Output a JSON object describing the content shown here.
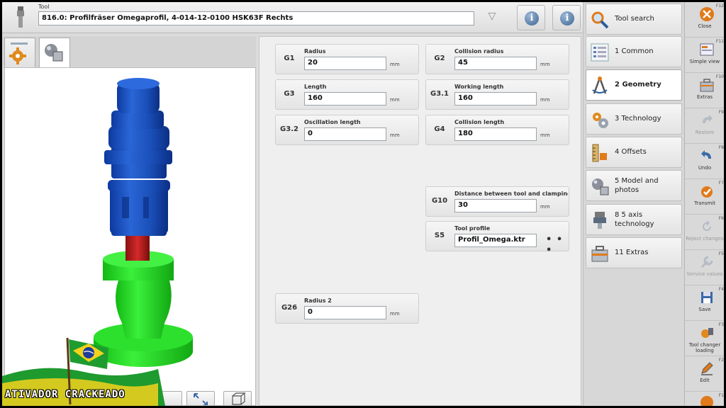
{
  "header": {
    "tool_caption": "Tool",
    "tool_value": "816.0: Profilfräser Omegaprofil, 4-014-12-0100 HSK63F Rechts",
    "dropdown_glyph": "▽",
    "info_glyph": "i"
  },
  "fields": [
    {
      "code": "G1",
      "label": "Radius",
      "value": "20",
      "unit": "mm"
    },
    {
      "code": "G2",
      "label": "Collision radius",
      "value": "45",
      "unit": "mm"
    },
    {
      "code": "G3",
      "label": "Length",
      "value": "160",
      "unit": "mm"
    },
    {
      "code": "G3.1",
      "label": "Working length",
      "value": "160",
      "unit": "mm"
    },
    {
      "code": "G3.2",
      "label": "Oscillation length",
      "value": "0",
      "unit": "mm"
    },
    {
      "code": "G4",
      "label": "Collision length",
      "value": "180",
      "unit": "mm"
    },
    {
      "code": "G10",
      "label": "Distance between tool and clamping eq...",
      "value": "30",
      "unit": "mm"
    },
    {
      "code": "S5",
      "label": "Tool profile",
      "value": "Profil_Omega.ktr",
      "more": "• • •"
    },
    {
      "code": "G26",
      "label": "Radius 2",
      "value": "0",
      "unit": "mm"
    }
  ],
  "categories": [
    {
      "label": "Tool search"
    },
    {
      "label": "1 Common"
    },
    {
      "label": "2 Geometry"
    },
    {
      "label": "3 Technology"
    },
    {
      "label": "4 Offsets"
    },
    {
      "label": "5 Model and photos"
    },
    {
      "label": "8 5 axis technology"
    },
    {
      "label": "11 Extras"
    }
  ],
  "fkeys": [
    {
      "key": "F12",
      "label": "Close"
    },
    {
      "key": "F11",
      "label": "Simple view"
    },
    {
      "key": "F10",
      "label": "Extras"
    },
    {
      "key": "F9",
      "label": "Restore"
    },
    {
      "key": "F8",
      "label": "Undo"
    },
    {
      "key": "F7",
      "label": "Transmit"
    },
    {
      "key": "F6",
      "label": "Reject changes"
    },
    {
      "key": "F5",
      "label": "Service values"
    },
    {
      "key": "F4",
      "label": "Save"
    },
    {
      "key": "F3",
      "label": "Tool changer loading"
    },
    {
      "key": "F2",
      "label": "Edit"
    },
    {
      "key": "F1",
      "label": ""
    }
  ],
  "watermark": {
    "text": "ATIVADOR CRACKEADO"
  },
  "colors": {
    "tool_blue": "#1f55c2",
    "tool_green": "#22dd22",
    "tool_red": "#c81e1e",
    "accent": "#e56a1a"
  }
}
